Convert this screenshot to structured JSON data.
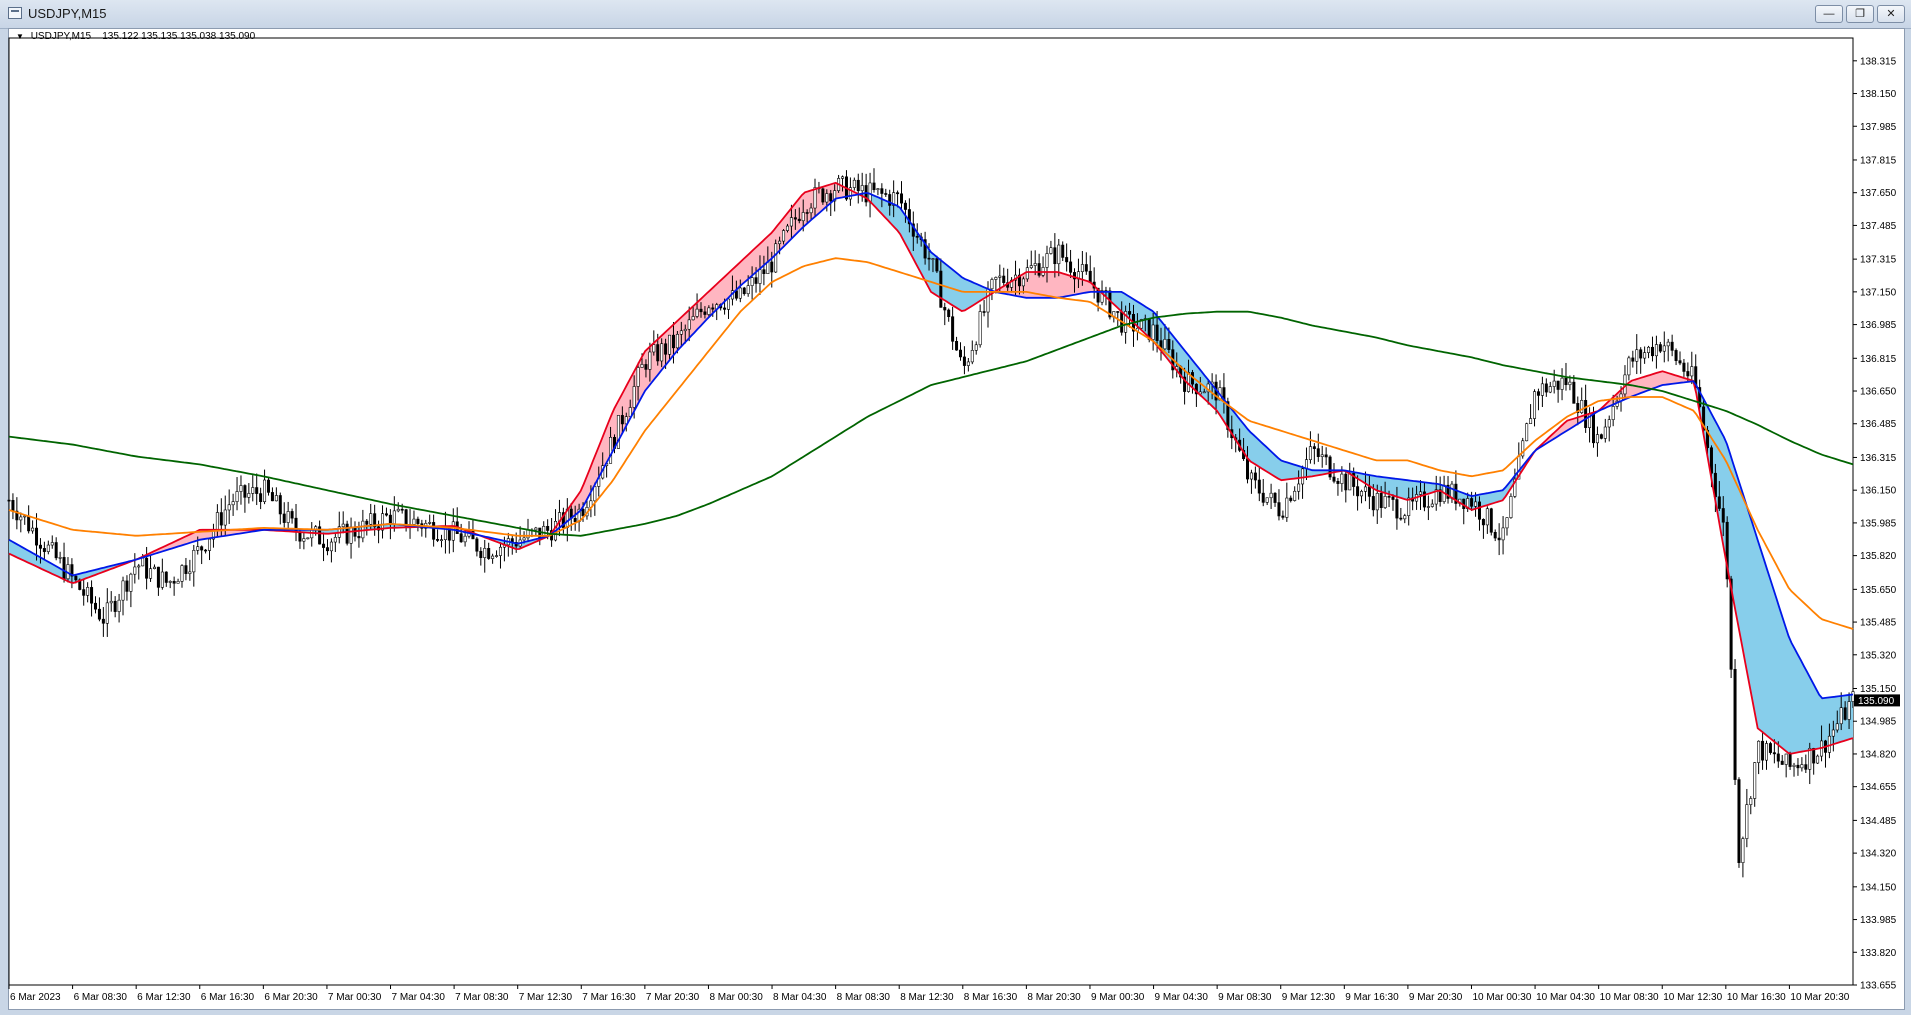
{
  "window": {
    "title": "USDJPY,M15",
    "buttons": {
      "minimize": "—",
      "restore": "❐",
      "close": "✕"
    }
  },
  "chart_header": {
    "symbol": "USDJPY,M15",
    "ohlc": "135.122 135.135 135.038 135.090"
  },
  "chart_data": {
    "type": "line",
    "title": "",
    "current_price": "135.090",
    "ylim": [
      133.655,
      138.43
    ],
    "y_ticks": [
      "138.315",
      "138.150",
      "137.985",
      "137.815",
      "137.650",
      "137.485",
      "137.315",
      "137.150",
      "136.985",
      "136.815",
      "136.650",
      "136.485",
      "136.315",
      "136.150",
      "135.985",
      "135.820",
      "135.650",
      "135.485",
      "135.320",
      "135.150",
      "134.985",
      "134.820",
      "134.655",
      "134.485",
      "134.320",
      "134.150",
      "133.985",
      "133.820",
      "133.655"
    ],
    "x_ticks": [
      "6 Mar 2023",
      "6 Mar 08:30",
      "6 Mar 12:30",
      "6 Mar 16:30",
      "6 Mar 20:30",
      "7 Mar 00:30",
      "7 Mar 04:30",
      "7 Mar 08:30",
      "7 Mar 12:30",
      "7 Mar 16:30",
      "7 Mar 20:30",
      "8 Mar 00:30",
      "8 Mar 04:30",
      "8 Mar 08:30",
      "8 Mar 12:30",
      "8 Mar 16:30",
      "8 Mar 20:30",
      "9 Mar 00:30",
      "9 Mar 04:30",
      "9 Mar 08:30",
      "9 Mar 12:30",
      "9 Mar 16:30",
      "9 Mar 20:30",
      "10 Mar 00:30",
      "10 Mar 04:30",
      "10 Mar 08:30",
      "10 Mar 12:30",
      "10 Mar 16:30",
      "10 Mar 20:30"
    ],
    "price_path": [
      [
        0,
        136.1
      ],
      [
        1,
        135.7
      ],
      [
        1.5,
        135.5
      ],
      [
        2,
        135.78
      ],
      [
        2.5,
        135.68
      ],
      [
        3,
        135.85
      ],
      [
        3.5,
        136.1
      ],
      [
        4,
        136.15
      ],
      [
        4.5,
        135.95
      ],
      [
        5,
        135.9
      ],
      [
        5.5,
        135.95
      ],
      [
        6,
        136.02
      ],
      [
        6.5,
        135.98
      ],
      [
        7,
        135.93
      ],
      [
        7.5,
        135.85
      ],
      [
        8,
        135.9
      ],
      [
        8.5,
        135.95
      ],
      [
        9,
        136.05
      ],
      [
        9.5,
        136.4
      ],
      [
        10,
        136.8
      ],
      [
        10.5,
        136.9
      ],
      [
        11,
        137.1
      ],
      [
        11.5,
        137.12
      ],
      [
        12,
        137.3
      ],
      [
        12.5,
        137.6
      ],
      [
        13,
        137.68
      ],
      [
        13.5,
        137.65
      ],
      [
        14,
        137.62
      ],
      [
        14.5,
        137.3
      ],
      [
        15,
        136.75
      ],
      [
        15.5,
        137.2
      ],
      [
        16,
        137.25
      ],
      [
        16.5,
        137.35
      ],
      [
        17,
        137.2
      ],
      [
        17.5,
        137.0
      ],
      [
        18,
        136.95
      ],
      [
        18.5,
        136.7
      ],
      [
        19,
        136.65
      ],
      [
        19.5,
        136.2
      ],
      [
        20,
        136.05
      ],
      [
        20.5,
        136.35
      ],
      [
        21,
        136.2
      ],
      [
        21.5,
        136.1
      ],
      [
        22,
        136.05
      ],
      [
        22.5,
        136.15
      ],
      [
        23,
        136.1
      ],
      [
        23.5,
        135.9
      ],
      [
        24,
        136.65
      ],
      [
        24.5,
        136.7
      ],
      [
        25,
        136.4
      ],
      [
        25.5,
        136.8
      ],
      [
        26,
        136.9
      ],
      [
        26.5,
        136.7
      ],
      [
        27,
        135.9
      ],
      [
        27.2,
        134.3
      ],
      [
        27.5,
        134.85
      ],
      [
        28,
        134.75
      ],
      [
        28.5,
        134.85
      ],
      [
        29,
        135.09
      ]
    ],
    "series": [
      {
        "id": "fast_ema",
        "color": "#e8001c",
        "points": [
          [
            0,
            135.83
          ],
          [
            1,
            135.68
          ],
          [
            2,
            135.8
          ],
          [
            3,
            135.95
          ],
          [
            4,
            135.95
          ],
          [
            5,
            135.93
          ],
          [
            6,
            135.96
          ],
          [
            7,
            135.97
          ],
          [
            8,
            135.85
          ],
          [
            8.5,
            135.92
          ],
          [
            9,
            136.15
          ],
          [
            9.5,
            136.55
          ],
          [
            10,
            136.85
          ],
          [
            10.5,
            137.0
          ],
          [
            11,
            137.15
          ],
          [
            11.5,
            137.3
          ],
          [
            12,
            137.45
          ],
          [
            12.5,
            137.65
          ],
          [
            13,
            137.7
          ],
          [
            13.5,
            137.62
          ],
          [
            14,
            137.45
          ],
          [
            14.5,
            137.15
          ],
          [
            15,
            137.05
          ],
          [
            15.5,
            137.15
          ],
          [
            16,
            137.25
          ],
          [
            16.5,
            137.25
          ],
          [
            17,
            137.2
          ],
          [
            17.5,
            137.05
          ],
          [
            18,
            136.9
          ],
          [
            18.5,
            136.7
          ],
          [
            19,
            136.55
          ],
          [
            19.5,
            136.3
          ],
          [
            20,
            136.2
          ],
          [
            20.5,
            136.22
          ],
          [
            21,
            136.25
          ],
          [
            21.5,
            136.15
          ],
          [
            22,
            136.1
          ],
          [
            22.5,
            136.15
          ],
          [
            23,
            136.05
          ],
          [
            23.5,
            136.1
          ],
          [
            24,
            136.35
          ],
          [
            24.5,
            136.5
          ],
          [
            25,
            136.55
          ],
          [
            25.5,
            136.7
          ],
          [
            26,
            136.75
          ],
          [
            26.5,
            136.7
          ],
          [
            27,
            135.8
          ],
          [
            27.5,
            134.95
          ],
          [
            28,
            134.82
          ],
          [
            28.5,
            134.85
          ],
          [
            29,
            134.9
          ]
        ]
      },
      {
        "id": "slow_ema",
        "color": "#0018e8",
        "points": [
          [
            0,
            135.9
          ],
          [
            1,
            135.72
          ],
          [
            2,
            135.8
          ],
          [
            3,
            135.9
          ],
          [
            4,
            135.95
          ],
          [
            5,
            135.95
          ],
          [
            6,
            135.98
          ],
          [
            7,
            135.95
          ],
          [
            8,
            135.88
          ],
          [
            8.5,
            135.92
          ],
          [
            9,
            136.05
          ],
          [
            9.5,
            136.35
          ],
          [
            10,
            136.65
          ],
          [
            10.5,
            136.85
          ],
          [
            11,
            137.02
          ],
          [
            11.5,
            137.18
          ],
          [
            12,
            137.32
          ],
          [
            12.5,
            137.48
          ],
          [
            13,
            137.62
          ],
          [
            13.5,
            137.65
          ],
          [
            14,
            137.58
          ],
          [
            14.5,
            137.35
          ],
          [
            15,
            137.22
          ],
          [
            15.5,
            137.15
          ],
          [
            16,
            137.12
          ],
          [
            16.5,
            137.12
          ],
          [
            17,
            137.15
          ],
          [
            17.5,
            137.15
          ],
          [
            18,
            137.05
          ],
          [
            18.5,
            136.85
          ],
          [
            19,
            136.65
          ],
          [
            19.5,
            136.45
          ],
          [
            20,
            136.3
          ],
          [
            20.5,
            136.25
          ],
          [
            21,
            136.25
          ],
          [
            21.5,
            136.22
          ],
          [
            22,
            136.2
          ],
          [
            22.5,
            136.18
          ],
          [
            23,
            136.12
          ],
          [
            23.5,
            136.15
          ],
          [
            24,
            136.35
          ],
          [
            24.5,
            136.45
          ],
          [
            25,
            136.55
          ],
          [
            25.5,
            136.62
          ],
          [
            26,
            136.68
          ],
          [
            26.5,
            136.7
          ],
          [
            27,
            136.4
          ],
          [
            27.5,
            135.9
          ],
          [
            28,
            135.4
          ],
          [
            28.5,
            135.1
          ],
          [
            29,
            135.12
          ]
        ]
      },
      {
        "id": "mid_ema",
        "color": "#ff8000",
        "points": [
          [
            0,
            136.05
          ],
          [
            1,
            135.95
          ],
          [
            2,
            135.92
          ],
          [
            3,
            135.94
          ],
          [
            4,
            135.96
          ],
          [
            5,
            135.95
          ],
          [
            6,
            135.98
          ],
          [
            7,
            135.96
          ],
          [
            8,
            135.92
          ],
          [
            8.5,
            135.92
          ],
          [
            9,
            136.0
          ],
          [
            9.5,
            136.2
          ],
          [
            10,
            136.45
          ],
          [
            10.5,
            136.65
          ],
          [
            11,
            136.85
          ],
          [
            11.5,
            137.05
          ],
          [
            12,
            137.2
          ],
          [
            12.5,
            137.28
          ],
          [
            13,
            137.32
          ],
          [
            13.5,
            137.3
          ],
          [
            14,
            137.25
          ],
          [
            14.5,
            137.2
          ],
          [
            15,
            137.15
          ],
          [
            15.5,
            137.15
          ],
          [
            16,
            137.15
          ],
          [
            16.5,
            137.12
          ],
          [
            17,
            137.1
          ],
          [
            17.5,
            137.0
          ],
          [
            18,
            136.9
          ],
          [
            18.5,
            136.75
          ],
          [
            19,
            136.62
          ],
          [
            19.5,
            136.5
          ],
          [
            20,
            136.45
          ],
          [
            20.5,
            136.4
          ],
          [
            21,
            136.35
          ],
          [
            21.5,
            136.3
          ],
          [
            22,
            136.3
          ],
          [
            22.5,
            136.25
          ],
          [
            23,
            136.22
          ],
          [
            23.5,
            136.25
          ],
          [
            24,
            136.4
          ],
          [
            24.5,
            136.52
          ],
          [
            25,
            136.6
          ],
          [
            25.5,
            136.62
          ],
          [
            26,
            136.62
          ],
          [
            26.5,
            136.55
          ],
          [
            27,
            136.3
          ],
          [
            27.5,
            135.95
          ],
          [
            28,
            135.65
          ],
          [
            28.5,
            135.5
          ],
          [
            29,
            135.45
          ]
        ]
      },
      {
        "id": "long_ema",
        "color": "#006400",
        "points": [
          [
            0,
            136.42
          ],
          [
            1,
            136.38
          ],
          [
            2,
            136.32
          ],
          [
            3,
            136.28
          ],
          [
            4,
            136.22
          ],
          [
            5,
            136.15
          ],
          [
            6,
            136.08
          ],
          [
            7,
            136.02
          ],
          [
            8,
            135.96
          ],
          [
            8.5,
            135.93
          ],
          [
            9,
            135.92
          ],
          [
            9.5,
            135.95
          ],
          [
            10,
            135.98
          ],
          [
            10.5,
            136.02
          ],
          [
            11,
            136.08
          ],
          [
            11.5,
            136.15
          ],
          [
            12,
            136.22
          ],
          [
            12.5,
            136.32
          ],
          [
            13,
            136.42
          ],
          [
            13.5,
            136.52
          ],
          [
            14,
            136.6
          ],
          [
            14.5,
            136.68
          ],
          [
            15,
            136.72
          ],
          [
            15.5,
            136.76
          ],
          [
            16,
            136.8
          ],
          [
            16.5,
            136.86
          ],
          [
            17,
            136.92
          ],
          [
            17.5,
            136.98
          ],
          [
            18,
            137.02
          ],
          [
            18.5,
            137.04
          ],
          [
            19,
            137.05
          ],
          [
            19.5,
            137.05
          ],
          [
            20,
            137.02
          ],
          [
            20.5,
            136.98
          ],
          [
            21,
            136.95
          ],
          [
            21.5,
            136.92
          ],
          [
            22,
            136.88
          ],
          [
            22.5,
            136.85
          ],
          [
            23,
            136.82
          ],
          [
            23.5,
            136.78
          ],
          [
            24,
            136.75
          ],
          [
            24.5,
            136.72
          ],
          [
            25,
            136.7
          ],
          [
            25.5,
            136.68
          ],
          [
            26,
            136.65
          ],
          [
            26.5,
            136.6
          ],
          [
            27,
            136.55
          ],
          [
            27.5,
            136.48
          ],
          [
            28,
            136.4
          ],
          [
            28.5,
            136.33
          ],
          [
            29,
            136.28
          ]
        ]
      }
    ],
    "fills": {
      "bull_color": "#ffb6c1",
      "bear_color": "#87ceeb"
    },
    "grid": false,
    "background": "#ffffff"
  }
}
